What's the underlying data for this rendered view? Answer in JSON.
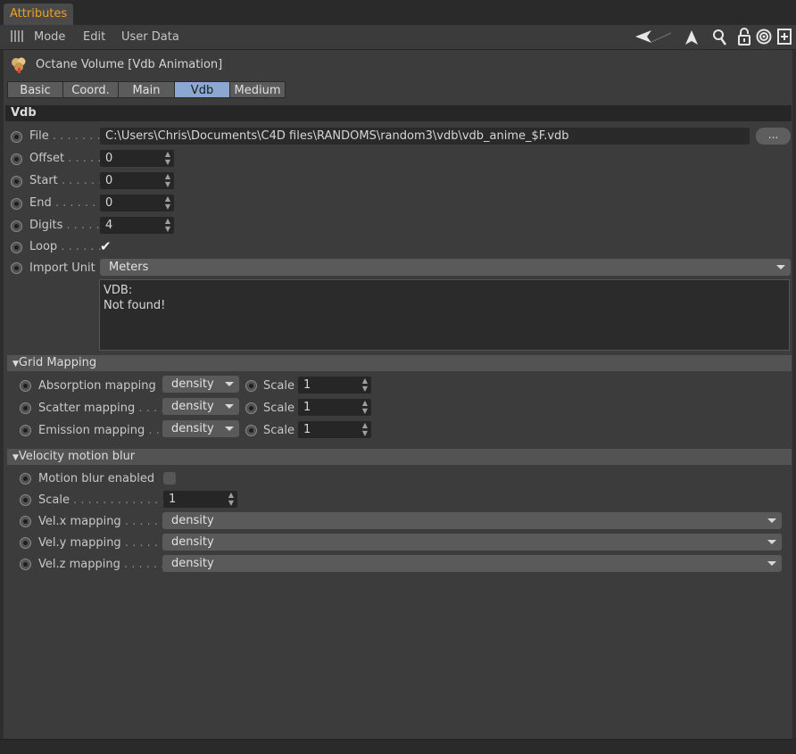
{
  "window": {
    "tab_title": "Attributes"
  },
  "menu": {
    "mode": "Mode",
    "edit": "Edit",
    "user_data": "User Data"
  },
  "toolbar_icons": [
    "back-arrow-icon",
    "up-arrow-icon",
    "search-icon",
    "lock-icon",
    "target-icon",
    "new-panel-icon"
  ],
  "object": {
    "title": "Octane Volume [Vdb  Animation]",
    "icon": "volume-object-icon"
  },
  "tabs": [
    {
      "label": "Basic",
      "active": false
    },
    {
      "label": "Coord.",
      "active": false
    },
    {
      "label": "Main",
      "active": false
    },
    {
      "label": "Vdb",
      "active": true
    },
    {
      "label": "Medium",
      "active": false
    }
  ],
  "vdb": {
    "section_title": "Vdb",
    "file": {
      "label": "File",
      "dots": " . . . . . . .",
      "value": "C:\\Users\\Chris\\Documents\\C4D files\\RANDOMS\\random3\\vdb\\vdb_anime_$F.vdb",
      "browse": "..."
    },
    "offset": {
      "label": "Offset",
      "dots": " . . . . .",
      "value": "0"
    },
    "start": {
      "label": "Start",
      "dots": " . . . . . .",
      "value": "0"
    },
    "end": {
      "label": "End",
      "dots": " . . . . . . .",
      "value": "0"
    },
    "digits": {
      "label": "Digits",
      "dots": " . . . . .",
      "value": "4"
    },
    "loop": {
      "label": "Loop",
      "dots": " . . . . . .",
      "checked": true,
      "check_glyph": "✔"
    },
    "import_unit": {
      "label": "Import Unit",
      "value": "Meters"
    },
    "info": {
      "line1": "VDB:",
      "line2": "Not found!"
    }
  },
  "grid_mapping": {
    "title": "Grid Mapping",
    "scale_label": "Scale",
    "rows": [
      {
        "label": "Absorption mapping",
        "dots": "",
        "value": "density",
        "scale": "1"
      },
      {
        "label": "Scatter mapping",
        "dots": " . . . .",
        "value": "density",
        "scale": "1"
      },
      {
        "label": "Emission mapping",
        "dots": " . .",
        "value": "density",
        "scale": "1"
      }
    ]
  },
  "velocity": {
    "title": "Velocity motion blur",
    "motion_blur": {
      "label": "Motion blur enabled",
      "checked": false
    },
    "scale": {
      "label": "Scale",
      "dots": " . . . . . . . . . . . . . .",
      "value": "1"
    },
    "velx": {
      "label": "Vel.x mapping",
      "dots": " . . . . . .",
      "value": "density"
    },
    "vely": {
      "label": "Vel.y mapping",
      "dots": " . . . . . .",
      "value": "density"
    },
    "velz": {
      "label": "Vel.z mapping",
      "dots": " . . . . . .",
      "value": "density"
    }
  },
  "colors": {
    "accent": "#f0a020",
    "active_tab": "#8aa8d2",
    "panel": "#3c3c3c",
    "field": "#262626"
  }
}
